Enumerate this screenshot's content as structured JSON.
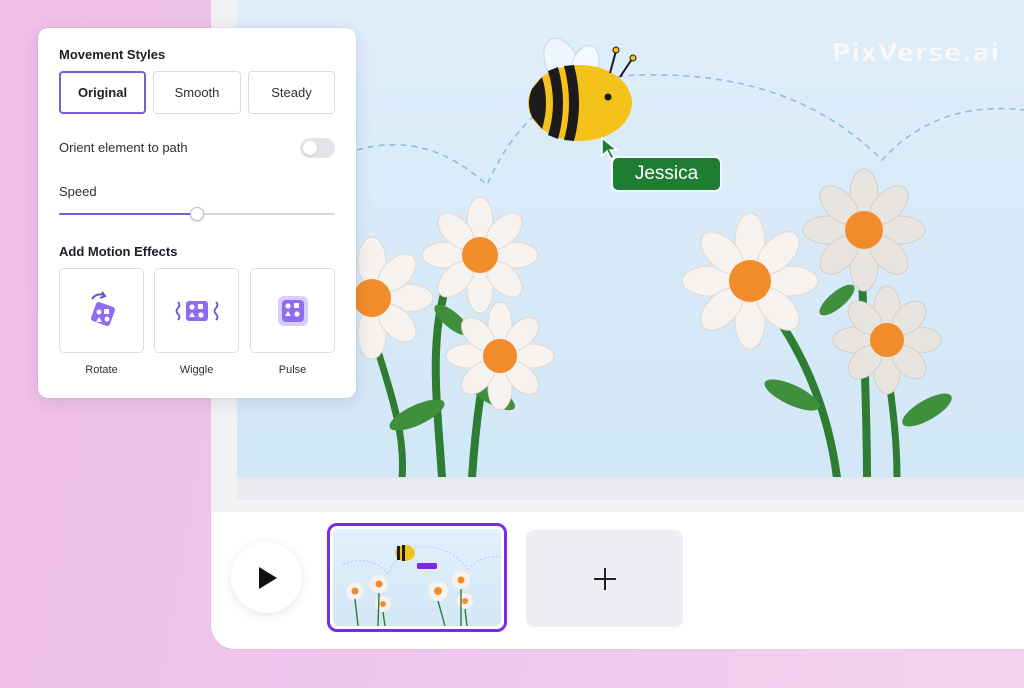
{
  "panel": {
    "movement_title": "Movement Styles",
    "styles": [
      {
        "label": "Original",
        "active": true
      },
      {
        "label": "Smooth",
        "active": false
      },
      {
        "label": "Steady",
        "active": false
      }
    ],
    "orient_label": "Orient element to path",
    "orient_enabled": false,
    "speed_label": "Speed",
    "speed_value": 0.5,
    "effects_title": "Add Motion Effects",
    "effects": [
      {
        "label": "Rotate",
        "icon": "rotate-effect-icon"
      },
      {
        "label": "Wiggle",
        "icon": "wiggle-effect-icon"
      },
      {
        "label": "Pulse",
        "icon": "pulse-effect-icon"
      }
    ]
  },
  "canvas": {
    "watermark": "PixVerse.ai",
    "collaborator_name": "Jessica"
  },
  "timeline": {
    "play_icon": "play-icon",
    "add_icon": "plus-icon"
  },
  "colors": {
    "accent": "#7b5cd6",
    "selected_page": "#7d2ae8",
    "name_tag": "#1e7d33"
  }
}
